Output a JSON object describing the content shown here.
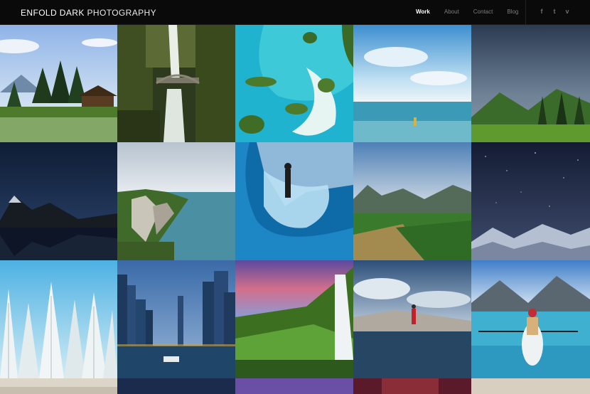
{
  "site": {
    "brand_first": "ENFOLD DARK",
    "brand_second": "PHOTOGRAPHY"
  },
  "nav": [
    {
      "label": "Work",
      "active": true
    },
    {
      "label": "About",
      "active": false
    },
    {
      "label": "Contact",
      "active": false
    },
    {
      "label": "Blog",
      "active": false
    }
  ],
  "social": [
    {
      "icon": "facebook-icon",
      "glyph": "f"
    },
    {
      "icon": "twitter-icon",
      "glyph": "t"
    },
    {
      "icon": "vimeo-icon",
      "glyph": "v"
    }
  ],
  "colors": {
    "header_bg": "#0a0a0a",
    "active_nav": "#ffffff",
    "inactive_nav": "#7c7c7c"
  }
}
